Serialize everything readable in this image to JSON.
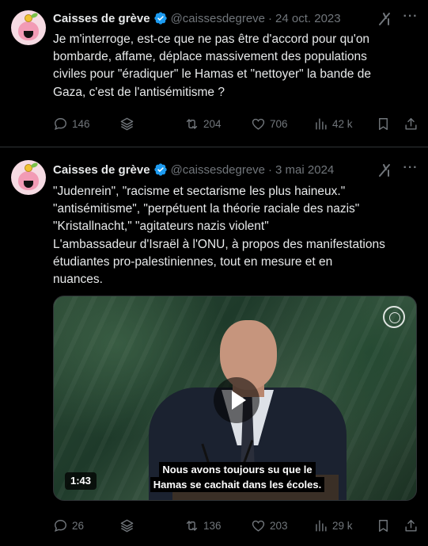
{
  "colors": {
    "background": "#000000",
    "text": "#e7e9ea",
    "muted": "#71767b",
    "verified": "#1d9bf0",
    "border": "#2f3336"
  },
  "tweets": [
    {
      "author": {
        "name": "Caisses de grève",
        "handle": "@caissesdegreve",
        "avatar": "piggy-bank-avatar"
      },
      "separator": "·",
      "date": "24 oct. 2023",
      "text_lines": [
        "Je m'interroge, est-ce que ne pas être d'accord pour qu'on",
        "bombarde, affame, déplace massivement des populations",
        "civiles pour \"éradiquer\" le Hamas et \"nettoyer\" la bande de",
        "Gaza, c'est de l'antisémitisme ?"
      ],
      "stats": {
        "replies": "146",
        "reposts": "204",
        "likes": "706",
        "views": "42 k"
      }
    },
    {
      "author": {
        "name": "Caisses de grève",
        "handle": "@caissesdegreve",
        "avatar": "piggy-bank-avatar"
      },
      "separator": "·",
      "date": "3 mai 2024",
      "text_lines": [
        "\"Judenrein\", \"racisme et sectarisme les plus haineux.\"",
        "\"antisémitisme\", \"perpétuent la théorie raciale des nazis\"",
        "\"Kristallnacht,\" \"agitateurs nazis violent\"",
        "L'ambassadeur d'Israël à l'ONU, à propos des manifestations",
        "étudiantes pro-palestiniennes, tout en mesure et en",
        "nuances."
      ],
      "video": {
        "duration": "1:43",
        "subtitle_lines": [
          "Nous avons toujours su que le",
          "Hamas se cachait dans les écoles."
        ]
      },
      "stats": {
        "replies": "26",
        "reposts": "136",
        "likes": "203",
        "views": "29 k"
      }
    }
  ]
}
